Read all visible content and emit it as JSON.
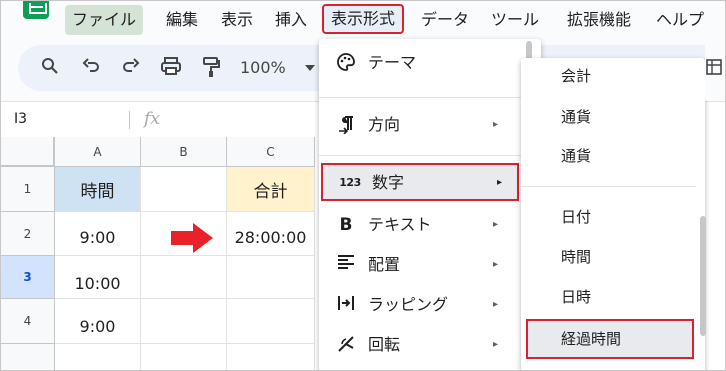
{
  "menubar": {
    "items": [
      "ファイル",
      "編集",
      "表示",
      "挿入",
      "表示形式",
      "データ",
      "ツール",
      "拡張機能",
      "ヘルプ"
    ]
  },
  "toolbar": {
    "zoom": "100%",
    "icons": [
      "search-icon",
      "undo-icon",
      "redo-icon",
      "print-icon",
      "paint-format-icon"
    ]
  },
  "formula_bar": {
    "cell_ref": "I3",
    "fx": "fx"
  },
  "grid": {
    "columns": [
      "A",
      "B",
      "C"
    ],
    "rows": [
      "1",
      "2",
      "3",
      "4"
    ],
    "cells": {
      "a1": "時間",
      "a2": "9:00",
      "a3": "10:00",
      "a4": "9:00",
      "c1": "合計",
      "c2": "28:00:00"
    },
    "colors": {
      "header_time": "#cfe2f3",
      "header_total": "#fff2cc",
      "arrow": "#e8212a",
      "highlight": "#d6232f"
    }
  },
  "format_menu": {
    "items": [
      {
        "icon": "palette-icon",
        "label": "テーマ"
      },
      {
        "icon": "text-direction-icon",
        "label": "方向",
        "submenu": "▸"
      },
      {
        "icon": "numbers-icon",
        "icon_text": "123",
        "label": "数字",
        "submenu": "▸"
      },
      {
        "icon": "bold-icon",
        "icon_text": "B",
        "label": "テキスト",
        "submenu": "▸"
      },
      {
        "icon": "align-icon",
        "label": "配置",
        "submenu": "▸"
      },
      {
        "icon": "wrap-icon",
        "label": "ラッピング",
        "submenu": "▸"
      },
      {
        "icon": "rotate-icon",
        "label": "回転",
        "submenu": "▸"
      }
    ]
  },
  "number_submenu": {
    "items": [
      "会計",
      "通貨",
      "通貨",
      "日付",
      "時間",
      "日時",
      "経過時間"
    ]
  }
}
